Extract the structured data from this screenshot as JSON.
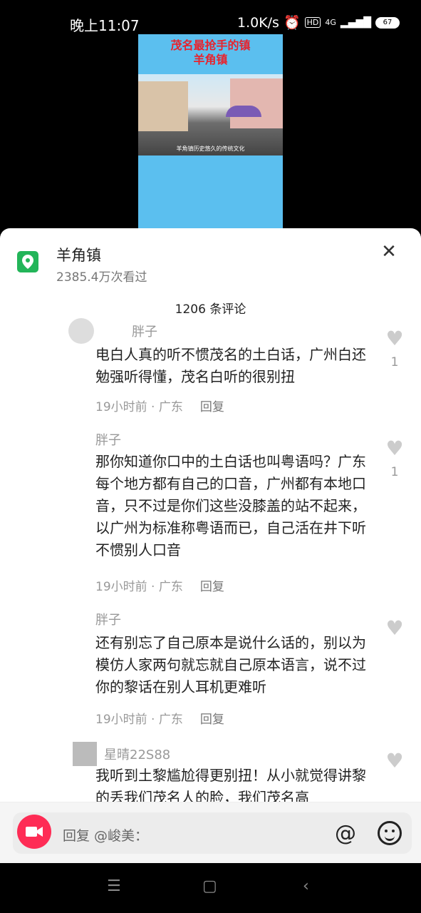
{
  "status": {
    "time": "晚上11:07",
    "speed": "1.0K/s",
    "battery": "67",
    "network": "4G",
    "hd": "HD"
  },
  "video": {
    "title_line1": "茂名最抢手的镇",
    "title_line2": "羊角镇",
    "caption": "羊角镇历史悠久的传统文化"
  },
  "location": {
    "name": "羊角镇",
    "views": "2385.4万次看过"
  },
  "comment_count": "1206 条评论",
  "comments": [
    {
      "user": "胖子",
      "text": "电白人真的听不惯茂名的土白话，广州白还勉强听得懂，茂名白听的很别扭",
      "meta": "19小时前 · 广东",
      "reply": "回复",
      "likes": "1"
    },
    {
      "user": "胖子",
      "text": "那你知道你口中的土白话也叫粤语吗？广东每个地方都有自己的口音，广州都有本地口音，只不过是你们这些没膝盖的站不起来，以广州为标准称粤语而已，自己活在井下听不惯别人口音",
      "meta": "19小时前 · 广东",
      "reply": "回复",
      "likes": "1"
    },
    {
      "user": "胖子",
      "text": "还有别忘了自己原本是说什么话的，别以为模仿人家两句就忘就自己原本语言，说不过你的黎话在别人耳机更难听",
      "meta": "19小时前 · 广东",
      "reply": "回复",
      "likes": ""
    },
    {
      "user": "星晴22S88",
      "text": "我听到土黎尴尬得更别扭！从小就觉得讲黎的丢我们茂名人的脸，我们茂名高",
      "meta": "",
      "reply": "",
      "likes": ""
    }
  ],
  "input": {
    "placeholder": "回复 @峻美："
  }
}
